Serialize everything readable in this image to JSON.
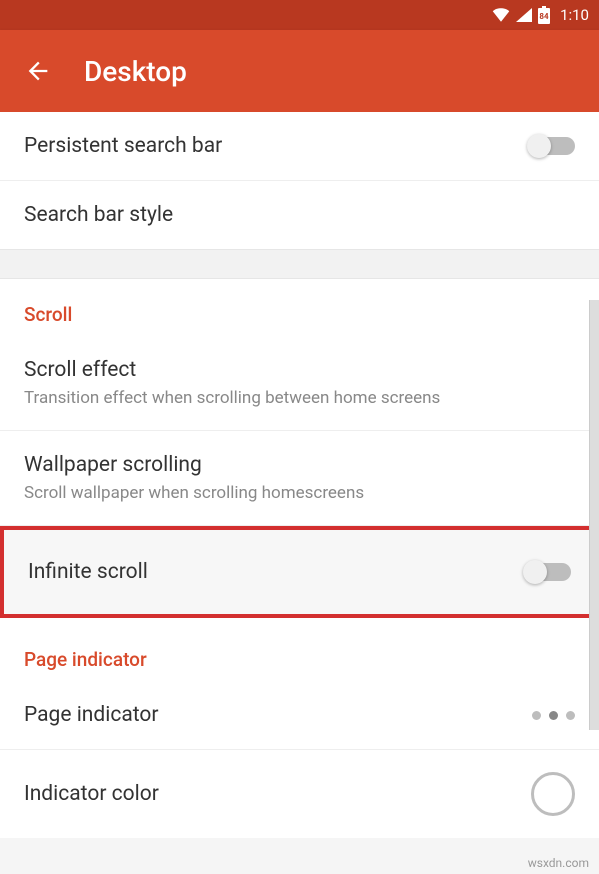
{
  "status": {
    "time": "1:10",
    "battery": "84"
  },
  "header": {
    "title": "Desktop"
  },
  "items": {
    "persistent_search": "Persistent search bar",
    "search_bar_style": "Search bar style"
  },
  "scroll": {
    "header": "Scroll",
    "effect_title": "Scroll effect",
    "effect_sub": "Transition effect when scrolling between home screens",
    "wallpaper_title": "Wallpaper scrolling",
    "wallpaper_sub": "Scroll wallpaper when scrolling homescreens",
    "infinite": "Infinite scroll"
  },
  "page_indicator": {
    "header": "Page indicator",
    "label": "Page indicator",
    "color": "Indicator color"
  },
  "watermark": "wsxdn.com"
}
